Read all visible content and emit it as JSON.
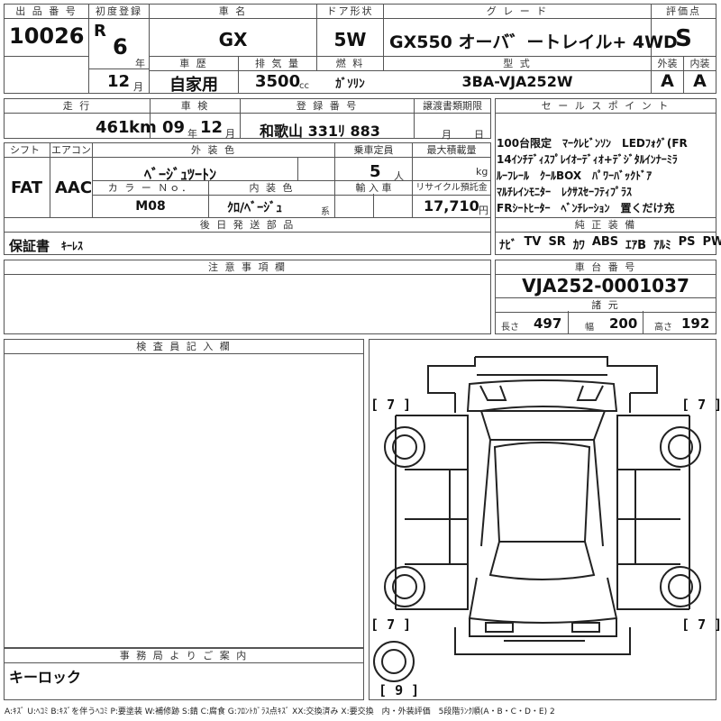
{
  "headers": {
    "lot_no": "出 品 番 号",
    "first_reg": "初度登録",
    "car_name": "車 名",
    "door": "ドア形状",
    "grade": "グ レ ー ド",
    "score": "評価点",
    "history": "車 歴",
    "displacement": "排 気 量",
    "fuel": "燃 料",
    "model": "型 式",
    "exterior": "外装",
    "interior": "内装",
    "mileage": "走 行",
    "inspection": "車 検",
    "reg_no": "登 録 番 号",
    "transfer_doc": "譲渡書類期限",
    "sales_points": "セ ー ル ス ポ イ ン ト",
    "shift": "シフト",
    "aircon": "エアコン",
    "ext_color": "外 装 色",
    "capacity": "乗車定員",
    "max_load": "最大積載量",
    "color_no": "カ ラ ー Ｎｏ．",
    "int_color": "内 装 色",
    "import": "輸 入 車",
    "recycle": "リサイクル預託金",
    "genuine_equipment": "純 正 装 備",
    "later_parts": "後 日 発 送 部 品",
    "notes": "注 意 事 項 欄",
    "chassis_no": "車 台 番 号",
    "specs": "諸 元",
    "inspector": "検 査 員 記 入 欄",
    "office_notice": "事 務 局 よ り ご 案 内"
  },
  "values": {
    "lot_no": "10026",
    "era": "R",
    "year": "6",
    "year_unit": "年",
    "month": "12",
    "month_unit": "月",
    "car_name": "GX",
    "door": "5W",
    "grade": "GX550 オーバ゛ートレイル+ 4WD",
    "score": "S",
    "history": "自家用",
    "displacement": "3500",
    "displacement_unit": "cc",
    "fuel": "ｶﾞｿﾘﾝ",
    "model": "3BA-VJA252W",
    "exterior_grade": "A",
    "interior_grade": "A",
    "mileage": "461",
    "mileage_unit": "km",
    "inspection_year": "09",
    "inspection_year_unit": "年",
    "inspection_month": "12",
    "inspection_month_unit": "月",
    "reg_no": "和歌山 331ﾘ 883",
    "transfer_month_unit": "月",
    "transfer_day_unit": "日",
    "shift": "FAT",
    "aircon": "AAC",
    "ext_color": "ﾍﾞｰｼﾞｭﾂｰﾄﾝ",
    "capacity": "5",
    "capacity_unit": "人",
    "max_load_unit": "kg",
    "color_no": "M08",
    "int_color": "ｸﾛ/ﾍﾞｰｼﾞｭ",
    "int_color_unit": "系",
    "recycle": "17,710",
    "recycle_unit": "円",
    "later_parts": "保証書",
    "later_parts_2": "ｷｰﾚｽ",
    "chassis_no": "VJA252-0001037",
    "length_label": "長さ",
    "length": "497",
    "width_label": "幅",
    "width": "200",
    "height_label": "高さ",
    "height": "192",
    "office_notice": "キーロック"
  },
  "sales_points": [
    "100台限定　ﾏｰｸﾚﾋﾞﾝｿﾝ　LEDﾌｫｸﾞ(FR",
    "14ｲﾝﾁﾃﾞｨｽﾌﾟﾚｲｵｰﾃﾞｨｵ+ﾃﾞｼﾞﾀﾙｲﾝﾅｰﾐﾗ",
    "ﾙｰﾌﾚｰﾙ　ｸｰﾙBOX　ﾊﾟﾜｰﾊﾞｯｸﾄﾞｱ",
    "ﾏﾙﾁﾚｲﾝﾓﾆﾀｰ　ﾚｸｻｽｾｰﾌﾃｨﾌﾟﾗｽ",
    "FRｼｰﾄﾋｰﾀｰ　ﾍﾞﾝﾁﾚｰｼｮﾝ　置くだけ充"
  ],
  "genuine_equipment": [
    "ﾅﾋﾞ",
    "TV",
    "SR",
    "ｶﾜ",
    "ABS",
    "ｴｱB",
    "ｱﾙﾐ",
    "PS",
    "PW"
  ],
  "diagram_marks": {
    "top_left": "7",
    "top_right": "7",
    "bottom_left": "7",
    "bottom_right": "7",
    "spare": "9"
  },
  "legend": "A:ｷｽﾞ U:ﾍｺﾐ B:ｷｽﾞを伴うﾍｺﾐ P:要塗装 W:補修跡 S:錆 C:腐食 G:ﾌﾛﾝﾄｶﾞﾗｽ点ｷｽﾞ XX:交換済み X:要交換　内・外装評価　5段階ﾗﾝｸ順(A・B・C・D・E) 2"
}
